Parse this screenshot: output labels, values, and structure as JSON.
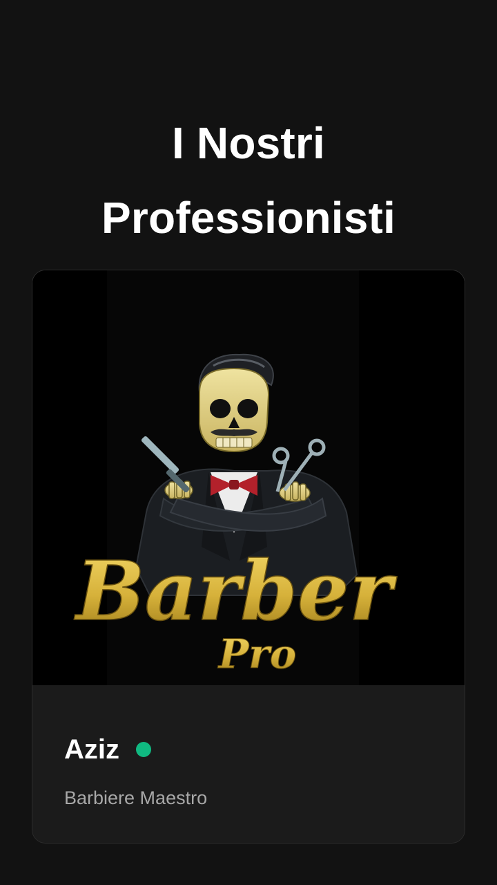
{
  "page": {
    "title": "I Nostri Professionisti"
  },
  "professionals": [
    {
      "name": "Aziz",
      "role": "Barbiere Maestro",
      "status": "online",
      "status_color": "#10b981",
      "image": {
        "logo_text_main": "Barber",
        "logo_text_sub": "Pro",
        "icon": "skull-barber-logo-icon"
      }
    }
  ],
  "colors": {
    "background": "#121212",
    "card_background": "#1b1b1b",
    "accent_gold": "#d6b13a"
  }
}
